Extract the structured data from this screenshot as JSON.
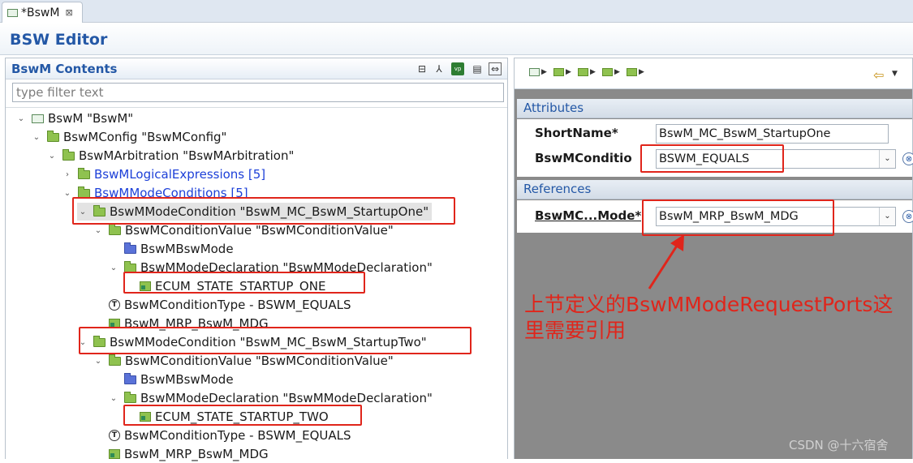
{
  "tab": {
    "label": "*BswM",
    "close_glyph": "⊠"
  },
  "editor": {
    "title": "BSW Editor"
  },
  "contents": {
    "title": "BswM Contents",
    "filter_placeholder": "type filter text",
    "tree": [
      {
        "label": "BswM \"BswM\"",
        "icon": "module-icon",
        "arrow": "⌄"
      },
      {
        "label": "BswMConfig \"BswMConfig\"",
        "icon": "folder-icon",
        "arrow": "⌄"
      },
      {
        "label": "BswMArbitration \"BswMArbitration\"",
        "icon": "folder-icon",
        "arrow": "⌄"
      },
      {
        "label": "BswMLogicalExpressions [5]",
        "icon": "folder-icon",
        "arrow": "›"
      },
      {
        "label": "BswMModeConditions [5]",
        "icon": "folder-icon",
        "arrow": "⌄"
      },
      {
        "label": "BswMModeCondition \"BswM_MC_BswM_StartupOne\"",
        "icon": "folder-icon",
        "arrow": "⌄"
      },
      {
        "label": "BswMConditionValue \"BswMConditionValue\"",
        "icon": "folder-icon",
        "arrow": "⌄"
      },
      {
        "label": "BswMBswMode",
        "icon": "folder-blue-icon",
        "arrow": ""
      },
      {
        "label": "BswMModeDeclaration \"BswMModeDeclaration\"",
        "icon": "folder-icon",
        "arrow": "⌄"
      },
      {
        "label": "ECUM_STATE_STARTUP_ONE",
        "icon": "reference-icon",
        "arrow": ""
      },
      {
        "label": "BswMConditionType - BSWM_EQUALS",
        "icon": "type-icon",
        "arrow": ""
      },
      {
        "label": "BswM_MRP_BswM_MDG",
        "icon": "reference-icon",
        "arrow": ""
      },
      {
        "label": "BswMModeCondition \"BswM_MC_BswM_StartupTwo\"",
        "icon": "folder-icon",
        "arrow": "⌄"
      },
      {
        "label": "BswMConditionValue \"BswMConditionValue\"",
        "icon": "folder-icon",
        "arrow": "⌄"
      },
      {
        "label": "BswMBswMode",
        "icon": "folder-blue-icon",
        "arrow": ""
      },
      {
        "label": "BswMModeDeclaration \"BswMModeDeclaration\"",
        "icon": "folder-icon",
        "arrow": "⌄"
      },
      {
        "label": "ECUM_STATE_STARTUP_TWO",
        "icon": "reference-icon",
        "arrow": ""
      },
      {
        "label": "BswMConditionType - BSWM_EQUALS",
        "icon": "type-icon",
        "arrow": ""
      },
      {
        "label": "BswM_MRP_BswM_MDG",
        "icon": "reference-icon",
        "arrow": ""
      }
    ],
    "type_icon_glyph": "T"
  },
  "attributes": {
    "title": "Attributes",
    "shortname_label": "ShortName*",
    "shortname_value": "BswM_MC_BswM_StartupOne",
    "condition_label": "BswMCondition",
    "condition_value": "BSWM_EQUALS"
  },
  "references": {
    "title": "References",
    "mode_label": "BswMC...Mode*",
    "mode_value": "BswM_MRP_BswM_MDG"
  },
  "annotation": {
    "text": "上节定义的BswMModeRequestPorts这里需要引用"
  },
  "watermark": "CSDN @十六宿舍",
  "colors": {
    "accent": "#2458a6",
    "highlight": "#e0251b",
    "link": "#1d40d8"
  }
}
